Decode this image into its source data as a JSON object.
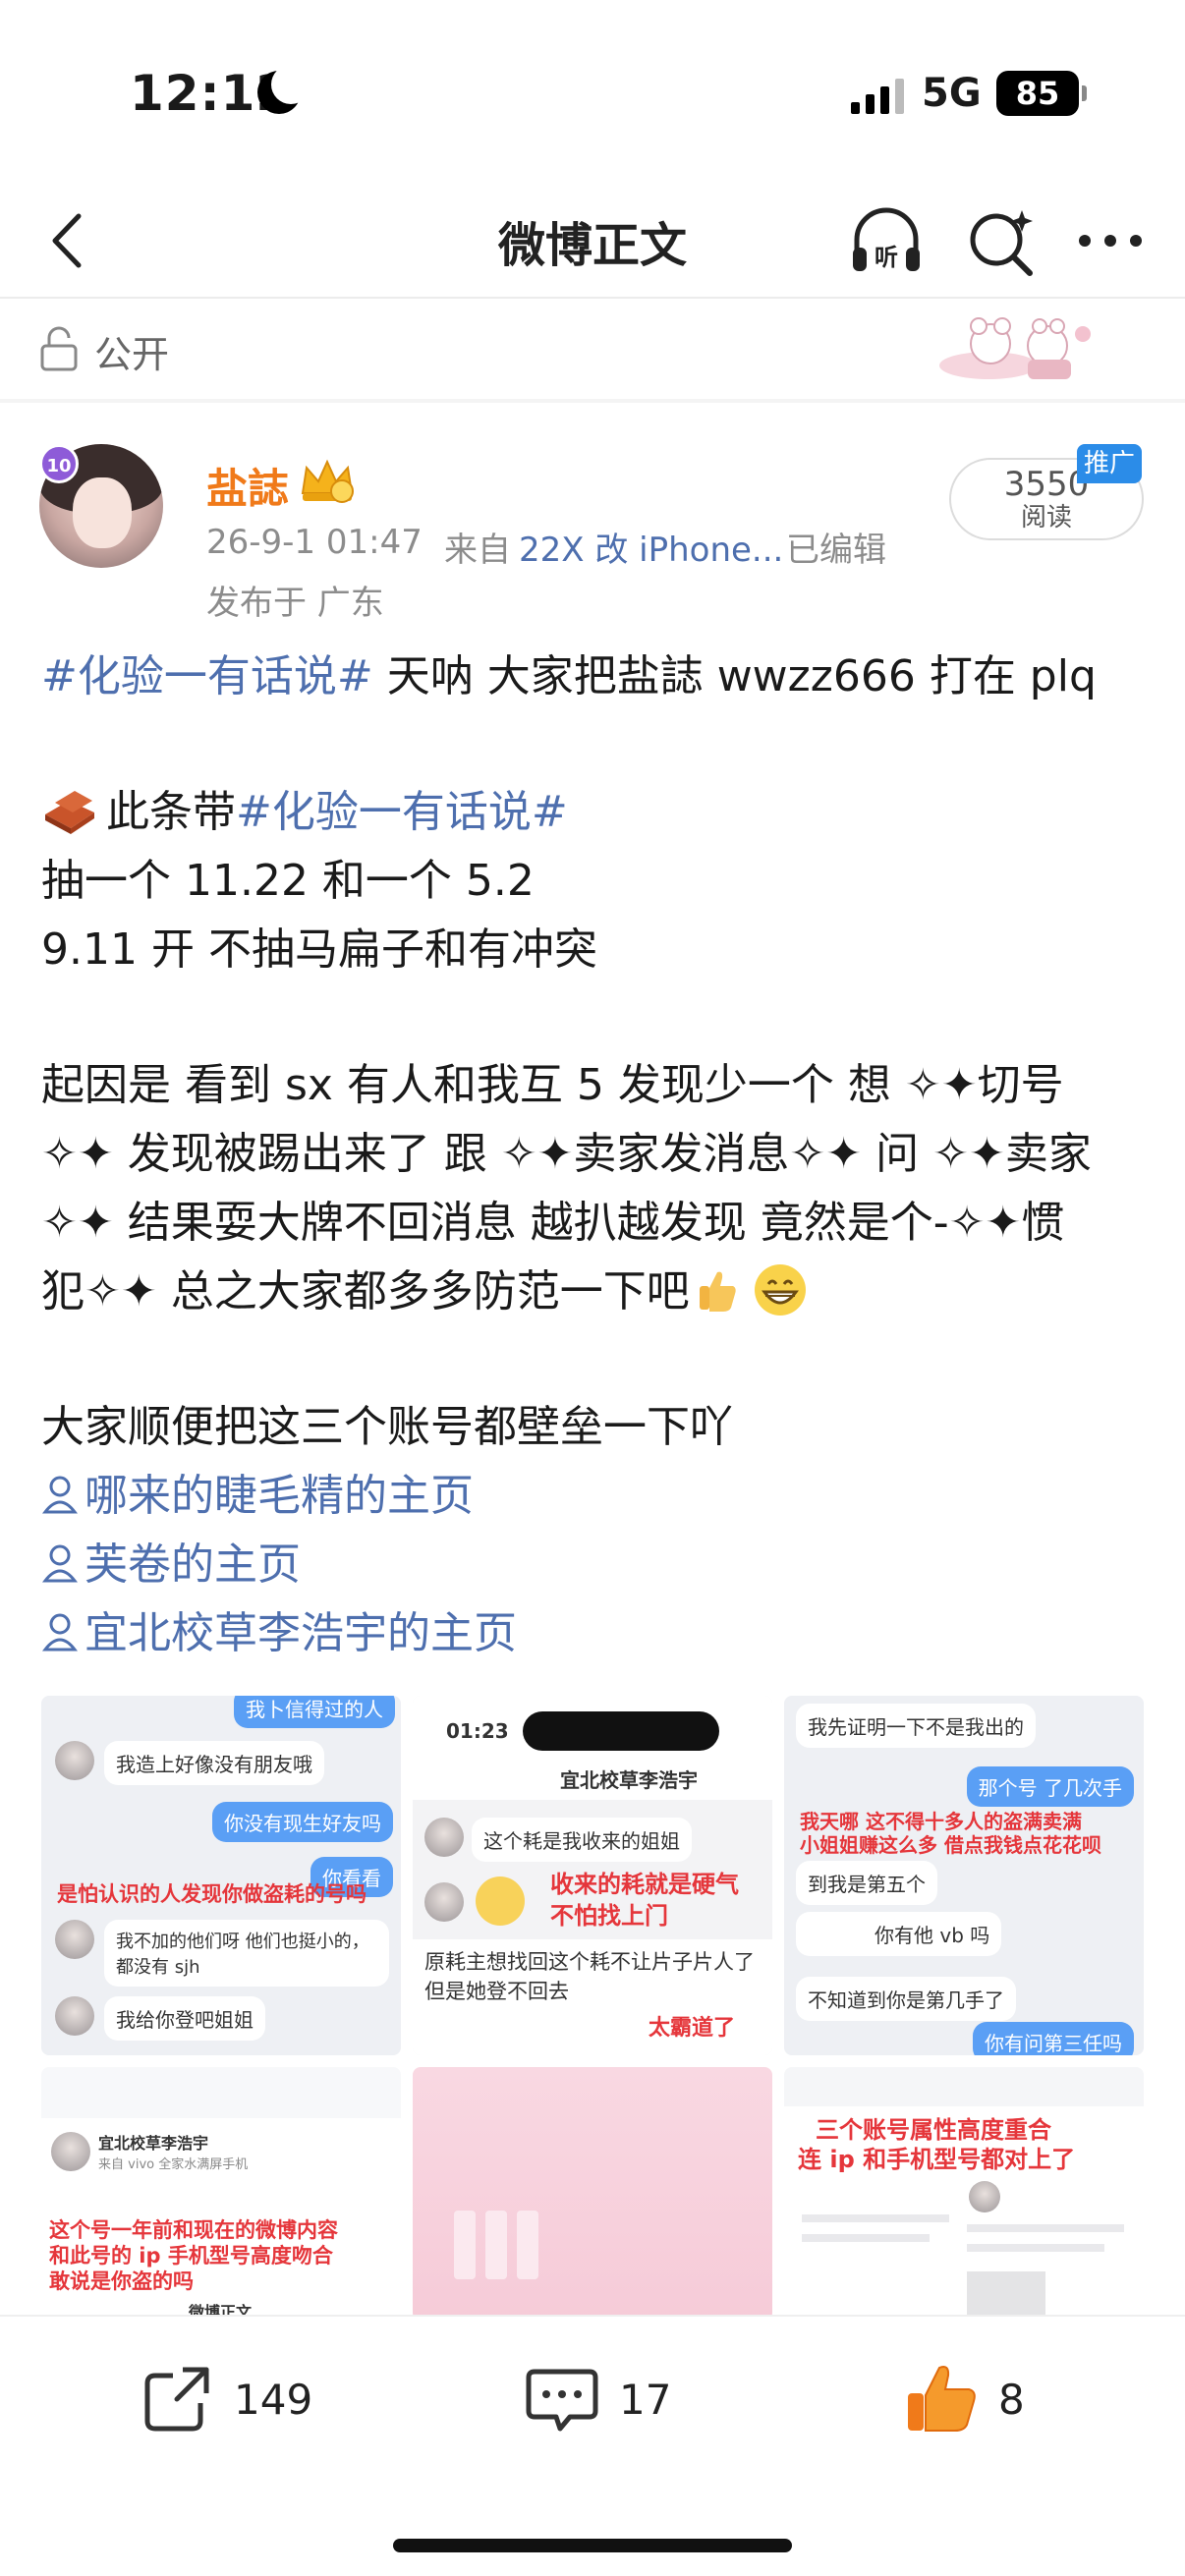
{
  "status_bar": {
    "time": "12:12",
    "network": "5G",
    "battery": "85"
  },
  "nav": {
    "title": "微博正文"
  },
  "visibility": {
    "label": "公开"
  },
  "author": {
    "name": "盐誌",
    "vip_level": "10",
    "time": "26-9-1 01:47",
    "source_prefix": "来自",
    "source": "22X 改 iPhone...",
    "edited": "已编辑",
    "location": "发布于 广东"
  },
  "reads": {
    "count": "3550",
    "label": "阅读",
    "promo": "推广"
  },
  "post": {
    "line1_topic": "#化验一有话说#",
    "line1_text": " 天呐 大家把盐誌 wwzz666 打在 plq",
    "line2_prefix": "此条带",
    "line2_topic": "#化验一有话说#",
    "line3": "抽一个 11.22 和一个 5.2",
    "line4": "9.11 开 不抽马扁子和有冲突",
    "line5": "起因是 看到 sx 有人和我互 5 发现少一个 想 ✧✦切号",
    "line6": "✧✦ 发现被踢出来了 跟 ✧✦卖家发消息✧✦ 问 ✧✦卖家",
    "line7": "✧✦ 结果耍大牌不回消息 越扒越发现 竟然是个-✧✦惯",
    "line8": "犯✧✦ 总之大家都多多防范一下吧",
    "line9": "大家顺便把这三个账号都壁垒一下吖",
    "link1": "哪来的睫毛精的主页",
    "link2": "芙卷的主页",
    "link3": "宜北校草李浩宇的主页"
  },
  "images": {
    "t1": {
      "b1": "我卜信得过的人",
      "b2": "我造上好像没有朋友哦",
      "b3": "你没有现生好友吗",
      "b4": "你看看",
      "red1": "是怕认识的人发现你做盗耗的号吗",
      "b5": "我不加的他们呀 他们也挺小的，都没有 sjh",
      "b6": "我给你登吧姐姐"
    },
    "t2": {
      "time": "01:23",
      "title": "宜北校草李浩宇",
      "b1": "这个耗是我收来的姐姐",
      "red1": "收来的耗就是硬气",
      "red2": "不怕找上门",
      "b2": "原耗主想找回这个耗不让片子片人了但是她登不回去",
      "red3": "太霸道了"
    },
    "t3": {
      "b1": "我先证明一下不是我出的",
      "b2": "那个号 了几次手",
      "red1": "我天哪 这不得十多人的盗满卖满",
      "red2": "小姐姐赚这么多 借点我钱点花花呗",
      "b3": "到我是第五个",
      "b4": "你有他 vb 吗",
      "b5": "不知道到你是第几手了",
      "b6": "你有问第三任吗"
    },
    "t4": {
      "name": "宜北校草李浩宇",
      "device": "来自 vivo 全家水满屏手机",
      "red1": "这个号一年前和现在的微博内容",
      "red2": "和此号的 ip 手机型号高度吻合",
      "red3": "敢说是你盗的吗",
      "footer": "微博正文"
    },
    "t6": {
      "red1": "三个账号属性高度重合",
      "red2": "连 ip 和手机型号都对上了"
    }
  },
  "actions": {
    "share_count": "149",
    "comment_count": "17",
    "like_count": "8"
  }
}
